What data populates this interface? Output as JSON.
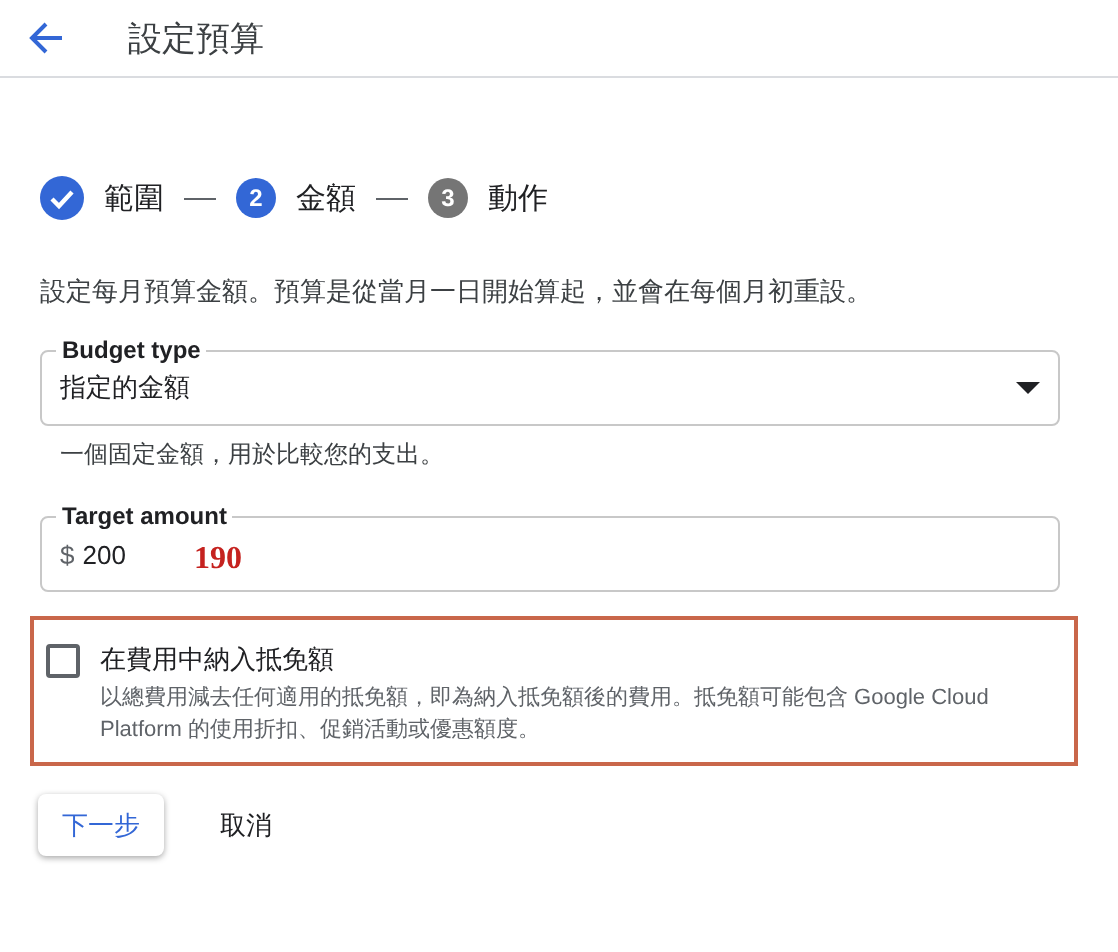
{
  "header": {
    "title": "設定預算"
  },
  "steps": [
    {
      "label": "範圍",
      "completed": true
    },
    {
      "number": "2",
      "label": "金額",
      "completed": false,
      "selected": true
    },
    {
      "number": "3",
      "label": "動作",
      "completed": false,
      "selected": false
    }
  ],
  "description": "設定每月預算金額。預算是從當月一日開始算起，並會在每個月初重設。",
  "budget_type": {
    "label": "Budget type",
    "value": "指定的金額",
    "helper": "一個固定金額，用於比較您的支出。"
  },
  "target_amount": {
    "label": "Target amount",
    "prefix": "$",
    "value": "200",
    "annotation": "190"
  },
  "credits": {
    "checked": false,
    "highlighted": true,
    "label": "在費用中納入抵免額",
    "description": "以總費用減去任何適用的抵免額，即為納入抵免額後的費用。抵免額可能包含 Google Cloud Platform 的使用折扣、促銷活動或優惠額度。"
  },
  "buttons": [
    {
      "label": "下一步",
      "kind": "raised"
    },
    {
      "label": "取消",
      "kind": "flat"
    }
  ]
}
